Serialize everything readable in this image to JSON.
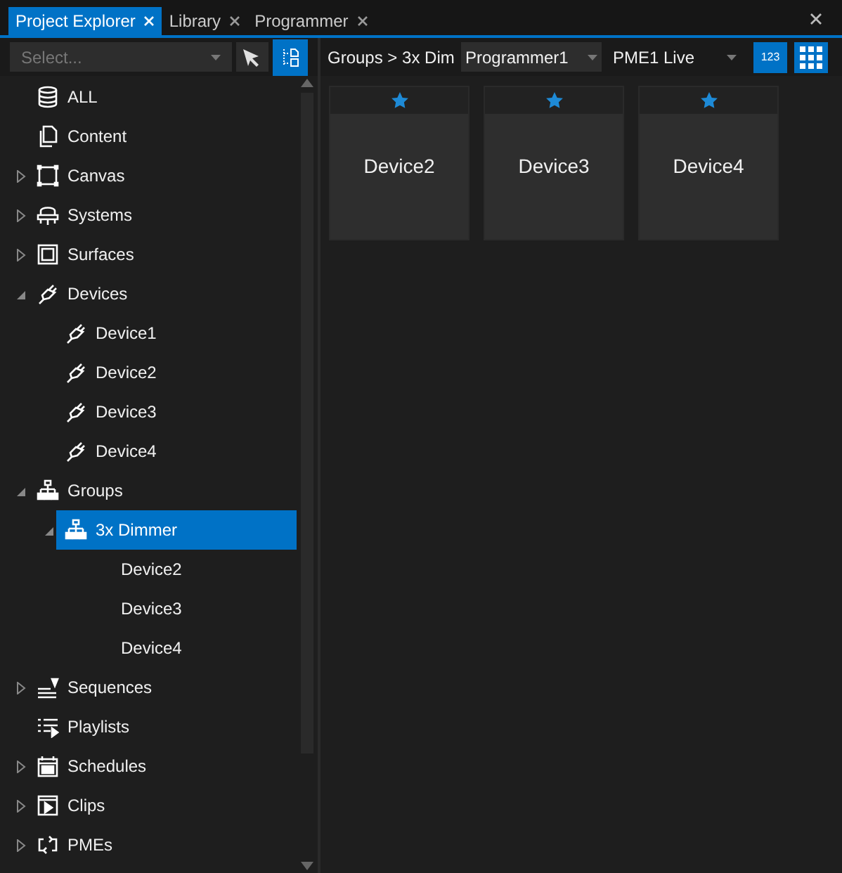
{
  "tabs": [
    {
      "label": "Project Explorer",
      "selected": true
    },
    {
      "label": "Library",
      "selected": false
    },
    {
      "label": "Programmer",
      "selected": false
    }
  ],
  "filter": {
    "placeholder": "Select..."
  },
  "tree": [
    {
      "label": "ALL",
      "kind": "database",
      "selected": false
    },
    {
      "label": "Content",
      "kind": "copy",
      "selected": false
    },
    {
      "label": "Canvas",
      "kind": "canvas",
      "expanded": false,
      "selected": false
    },
    {
      "label": "Systems",
      "kind": "server",
      "expanded": false,
      "selected": false
    },
    {
      "label": "Surfaces",
      "kind": "surface",
      "expanded": false,
      "selected": false
    },
    {
      "label": "Devices",
      "kind": "plug",
      "expanded": true,
      "selected": false,
      "children": [
        {
          "label": "Device1",
          "kind": "plug",
          "selected": false
        },
        {
          "label": "Device2",
          "kind": "plug",
          "selected": false
        },
        {
          "label": "Device3",
          "kind": "plug",
          "selected": false
        },
        {
          "label": "Device4",
          "kind": "plug",
          "selected": false
        }
      ]
    },
    {
      "label": "Groups",
      "kind": "group",
      "expanded": true,
      "selected": false,
      "children": [
        {
          "label": "3x Dimmer",
          "kind": "group",
          "expanded": true,
          "selected": true,
          "children": [
            {
              "label": "Device2",
              "selected": false
            },
            {
              "label": "Device3",
              "selected": false
            },
            {
              "label": "Device4",
              "selected": false
            }
          ]
        }
      ]
    },
    {
      "label": "Sequences",
      "kind": "sequence",
      "expanded": false,
      "selected": false
    },
    {
      "label": "Playlists",
      "kind": "playlist",
      "selected": false
    },
    {
      "label": "Schedules",
      "kind": "calendar",
      "expanded": false,
      "selected": false
    },
    {
      "label": "Clips",
      "kind": "clip",
      "expanded": false,
      "selected": false
    },
    {
      "label": "PMEs",
      "kind": "cycle",
      "expanded": false,
      "selected": false
    }
  ],
  "toolbar": {
    "breadcrumb": "Groups > 3x Dim",
    "programmer": "Programmer1",
    "pme": "PME1 Live",
    "numbers_button": "123",
    "grid_view": true
  },
  "tiles": [
    {
      "label": "Device2"
    },
    {
      "label": "Device3"
    },
    {
      "label": "Device4"
    }
  ]
}
